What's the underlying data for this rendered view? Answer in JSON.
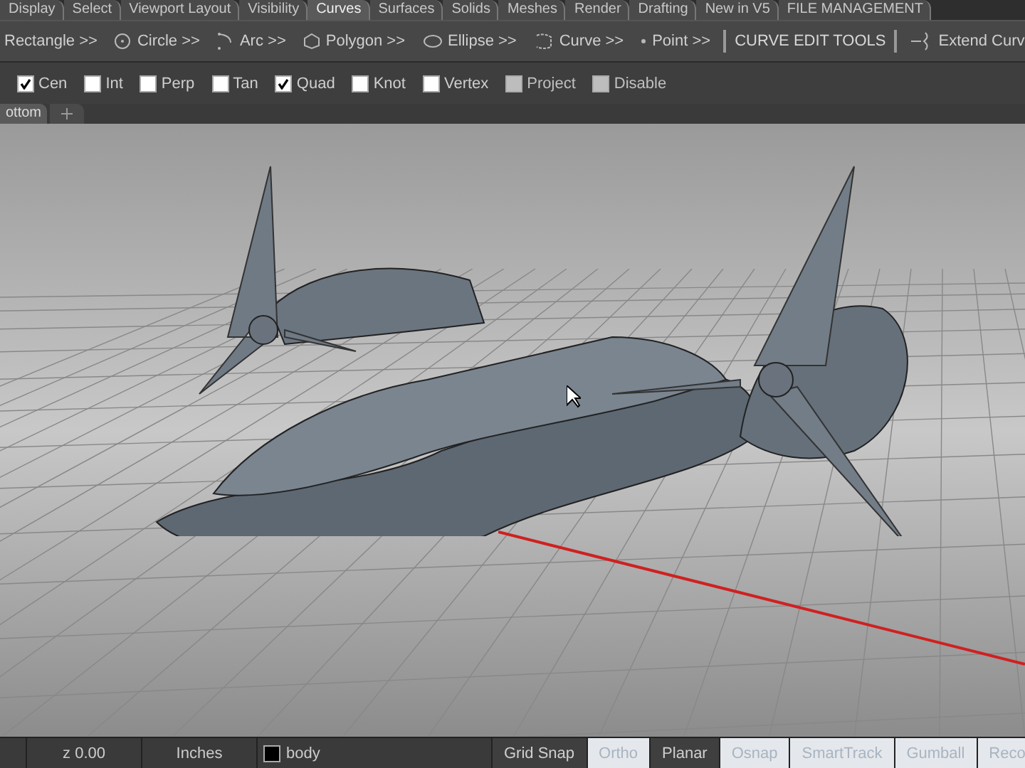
{
  "ribbon_tabs": [
    {
      "label": "Display",
      "selected": false
    },
    {
      "label": "Select",
      "selected": false
    },
    {
      "label": "Viewport Layout",
      "selected": false
    },
    {
      "label": "Visibility",
      "selected": false
    },
    {
      "label": "Curves",
      "selected": true
    },
    {
      "label": "Surfaces",
      "selected": false
    },
    {
      "label": "Solids",
      "selected": false
    },
    {
      "label": "Meshes",
      "selected": false
    },
    {
      "label": "Render",
      "selected": false
    },
    {
      "label": "Drafting",
      "selected": false
    },
    {
      "label": "New in V5",
      "selected": false
    },
    {
      "label": "FILE MANAGEMENT",
      "selected": false
    }
  ],
  "toolbar": [
    {
      "kind": "tool",
      "label": "Rectangle >>"
    },
    {
      "kind": "tool",
      "label": "Circle >>"
    },
    {
      "kind": "tool",
      "label": "Arc >>"
    },
    {
      "kind": "tool",
      "label": "Polygon >>"
    },
    {
      "kind": "tool",
      "label": "Ellipse >>"
    },
    {
      "kind": "tool",
      "label": "Curve >>"
    },
    {
      "kind": "tool",
      "label": "Point >>"
    },
    {
      "kind": "section",
      "label": "CURVE EDIT TOOLS"
    },
    {
      "kind": "command",
      "label": "Extend Curv"
    }
  ],
  "osnaps": [
    {
      "label": "Cen",
      "checked": true,
      "disabled": false
    },
    {
      "label": "Int",
      "checked": false,
      "disabled": false
    },
    {
      "label": "Perp",
      "checked": false,
      "disabled": false
    },
    {
      "label": "Tan",
      "checked": false,
      "disabled": false
    },
    {
      "label": "Quad",
      "checked": true,
      "disabled": false
    },
    {
      "label": "Knot",
      "checked": false,
      "disabled": false
    },
    {
      "label": "Vertex",
      "checked": false,
      "disabled": false
    },
    {
      "label": "Project",
      "checked": false,
      "disabled": true
    },
    {
      "label": "Disable",
      "checked": false,
      "disabled": true
    }
  ],
  "viewport_tabs": [
    {
      "label": "ottom",
      "selected": true
    }
  ],
  "status_bar": {
    "z": "z 0.00",
    "units": "Inches",
    "layer": {
      "name": "body",
      "color": "#000000"
    },
    "toggles": [
      {
        "label": "Grid Snap",
        "on": false
      },
      {
        "label": "Ortho",
        "on": true
      },
      {
        "label": "Planar",
        "on": false
      },
      {
        "label": "Osnap",
        "on": true
      },
      {
        "label": "SmartTrack",
        "on": true
      },
      {
        "label": "Gumball",
        "on": true
      },
      {
        "label": "Reco",
        "on": true
      }
    ]
  }
}
